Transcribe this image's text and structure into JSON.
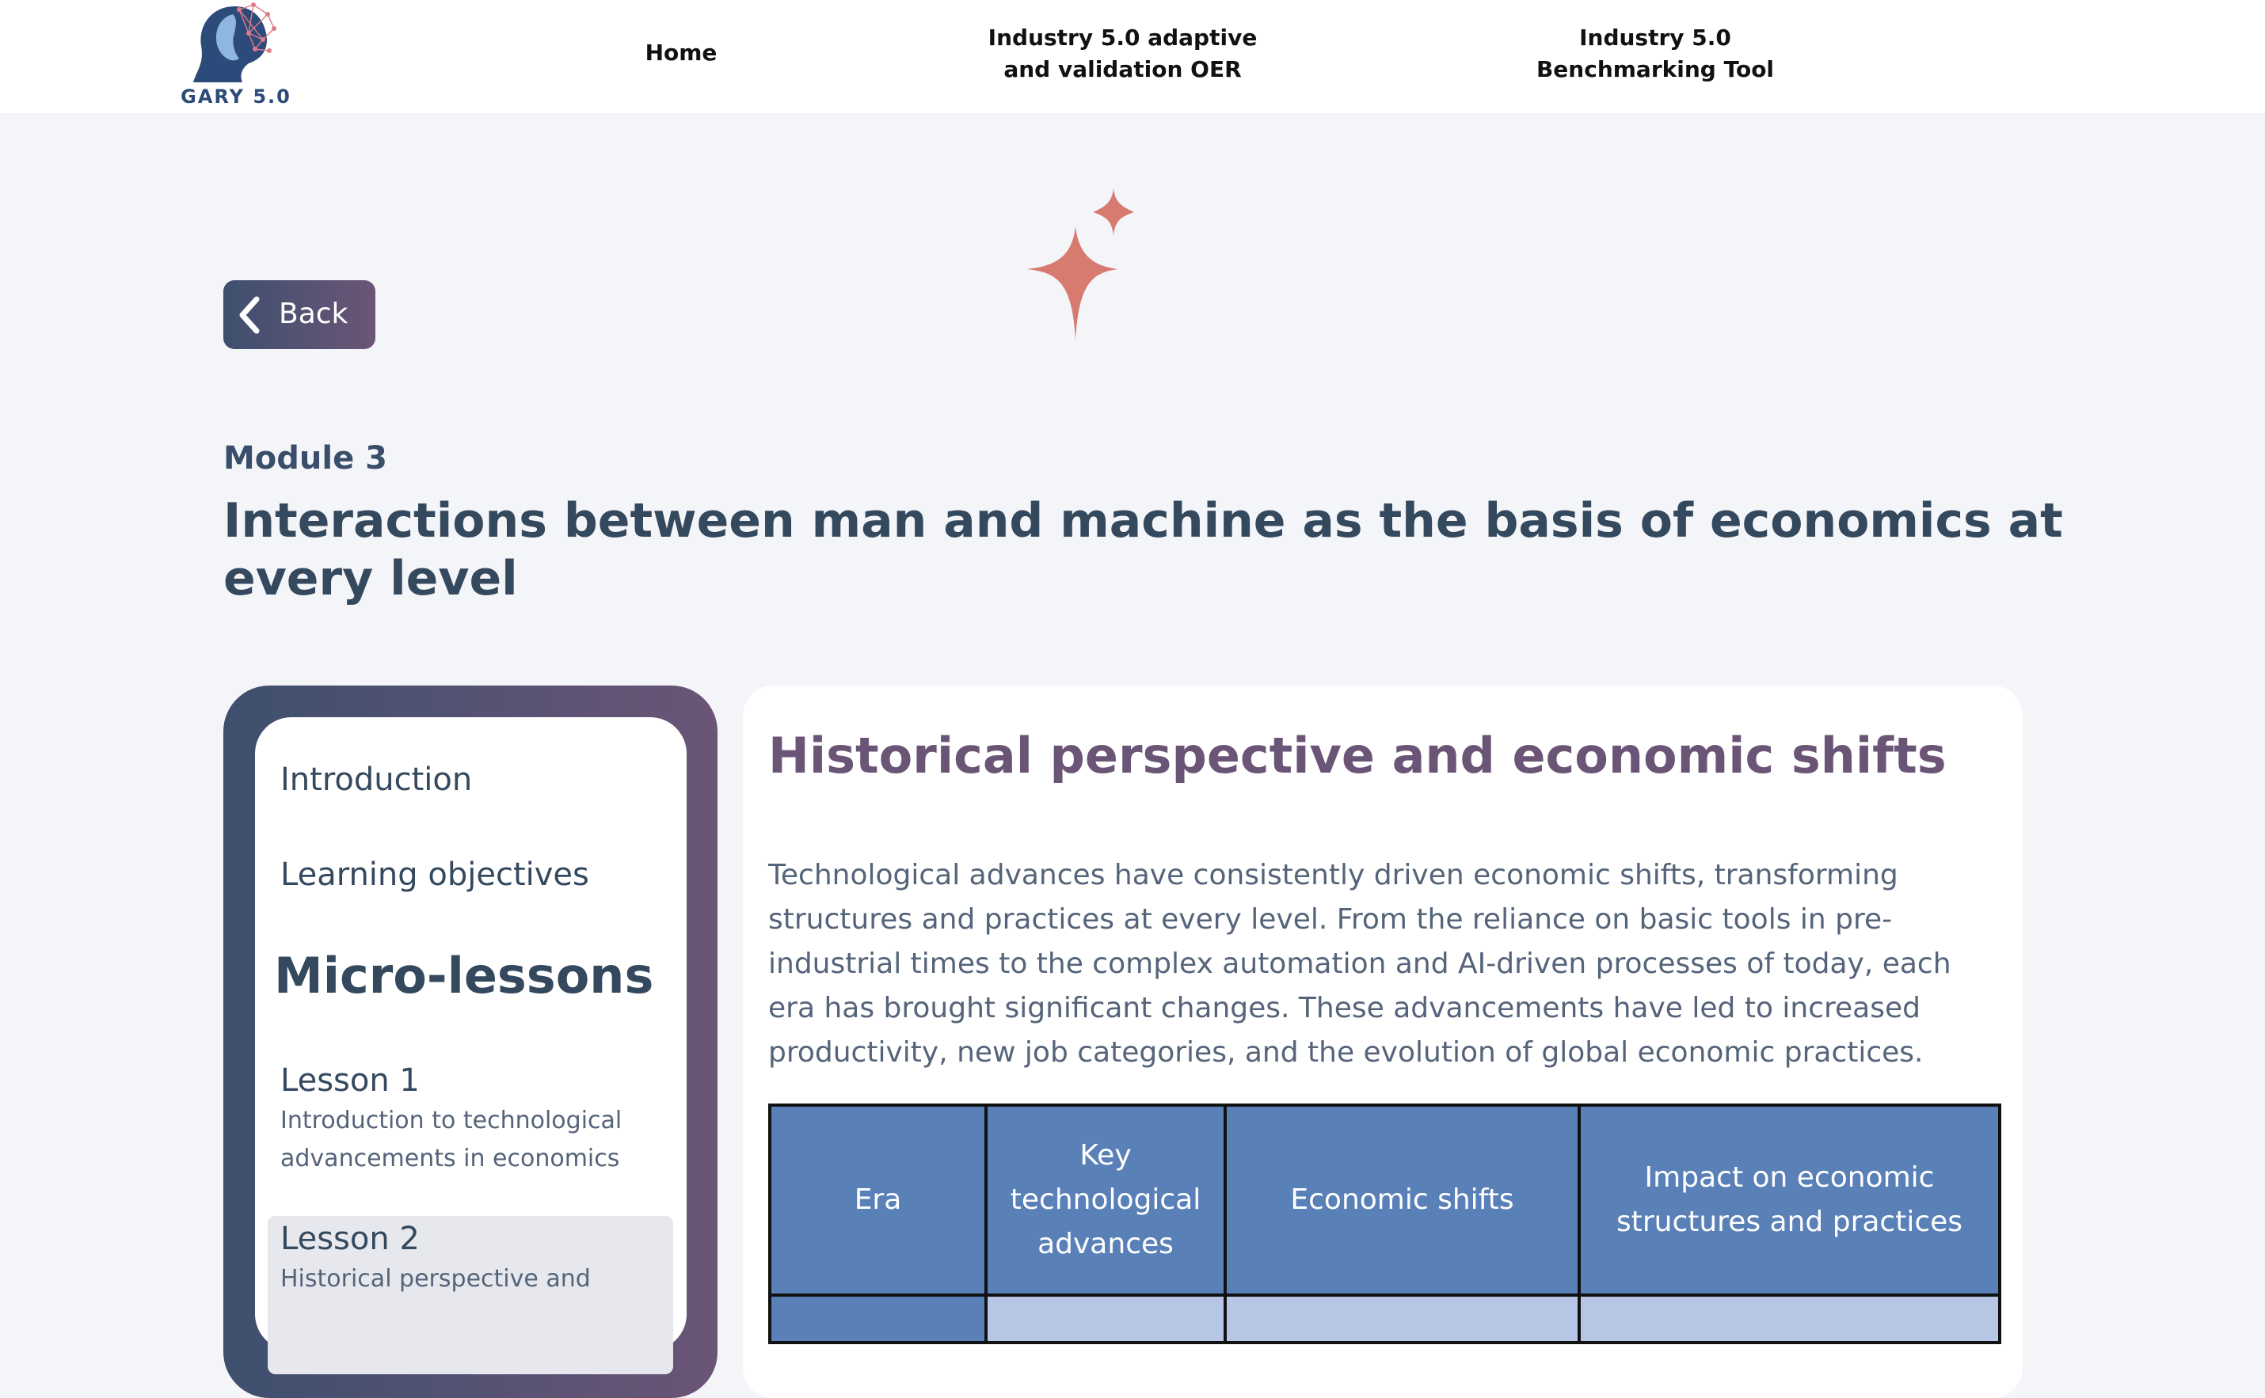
{
  "navbar": {
    "logo_text": "GARY 5.0",
    "links": [
      {
        "label": "Home"
      },
      {
        "label": "Industry 5.0 adaptive and validation OER"
      },
      {
        "label": "Industry 5.0 Benchmarking Tool"
      }
    ]
  },
  "back_button": {
    "label": "Back"
  },
  "module": {
    "label": "Module 3",
    "title": "Interactions between man and machine as the basis of economics at every level"
  },
  "sidebar": {
    "intro_label": "Introduction",
    "objectives_label": "Learning objectives",
    "micro_lessons_heading": "Micro-lessons",
    "lessons": [
      {
        "title": "Lesson 1",
        "subtitle": "Introduction to technological advancements in economics"
      },
      {
        "title": "Lesson 2",
        "subtitle": "Historical perspective and"
      }
    ]
  },
  "content": {
    "heading": "Historical perspective and economic shifts",
    "paragraph": "Technological advances have consistently driven economic shifts, transforming structures and practices at every level. From the reliance on basic tools in pre-industrial times to the complex automation and AI-driven processes of today, each era has brought significant changes. These advancements have led to increased productivity, new job categories, and the evolution of global economic practices.",
    "table": {
      "headers": [
        "Era",
        "Key technological advances",
        "Economic shifts",
        "Impact on economic structures and practices"
      ]
    }
  },
  "colors": {
    "accent_gradient_start": "#3e4f6e",
    "accent_gradient_end": "#6b5576",
    "sparkle": "#d77b70",
    "table_header": "#5a80b8",
    "table_body": "#b7c6e4"
  }
}
